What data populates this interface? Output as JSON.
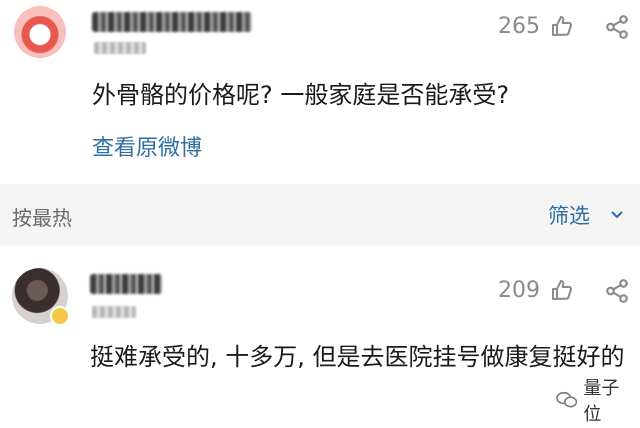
{
  "post": {
    "likes": "265",
    "comment": "外骨骼的价格呢? 一般家庭是否能承受?",
    "view_original": "查看原微博"
  },
  "sort": {
    "label": "按最热",
    "filter": "筛选"
  },
  "reply": {
    "likes": "209",
    "comment": "挺难承受的, 十多万, 但是去医院挂号做康复挺好的"
  },
  "watermark": {
    "text": "量子位"
  },
  "icons": [
    "avatar",
    "thumb-up-icon",
    "share-icon",
    "chevron-down-icon",
    "wechat-icon"
  ],
  "colors": {
    "link": "#2f6ea3",
    "muted": "#8a8a8a",
    "sortbar_bg": "#f4f4f4"
  }
}
